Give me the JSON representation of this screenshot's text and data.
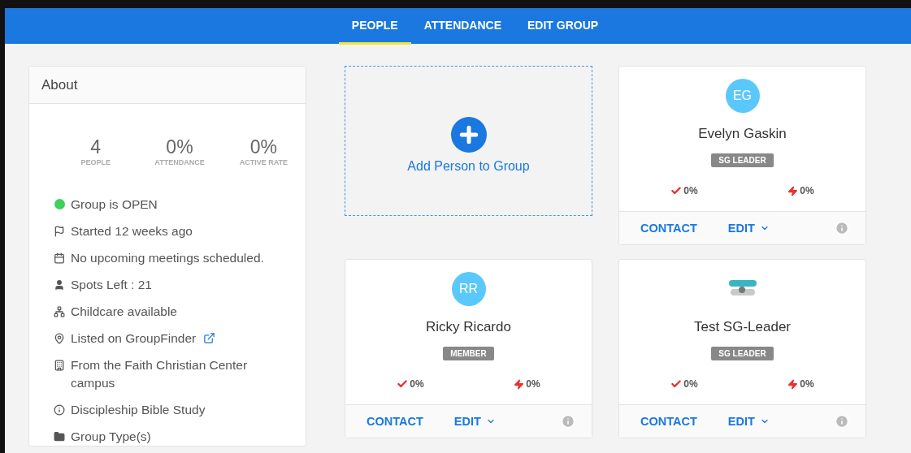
{
  "nav": {
    "tabs": [
      {
        "label": "PEOPLE",
        "selected": true
      },
      {
        "label": "ATTENDANCE",
        "selected": false
      },
      {
        "label": "EDIT GROUP",
        "selected": false
      }
    ]
  },
  "about": {
    "title": "About",
    "stats": [
      {
        "value": "4",
        "label": "PEOPLE"
      },
      {
        "value": "0%",
        "label": "ATTENDANCE"
      },
      {
        "value": "0%",
        "label": "ACTIVE RATE"
      }
    ],
    "details": [
      {
        "kind": "status",
        "text": "Group is OPEN",
        "color": "#3fd15c"
      },
      {
        "kind": "started",
        "text": "Started 12 weeks ago"
      },
      {
        "kind": "meetings",
        "text": "No upcoming meetings scheduled."
      },
      {
        "kind": "spots",
        "text": "Spots Left : 21"
      },
      {
        "kind": "childcare",
        "text": "Childcare available"
      },
      {
        "kind": "listing",
        "text": "Listed on GroupFinder"
      },
      {
        "kind": "campus",
        "text": "From the Faith Christian Center campus"
      },
      {
        "kind": "type",
        "text": "Discipleship Bible Study"
      },
      {
        "kind": "types",
        "text": "Group Type(s)"
      }
    ]
  },
  "add_card": {
    "label": "Add Person to Group"
  },
  "people": [
    {
      "avatar": {
        "kind": "initials",
        "text": "EG"
      },
      "name": "Evelyn Gaskin",
      "role": "SG LEADER",
      "attendance": "0%",
      "activity": "0%",
      "actions": [
        "CONTACT",
        "EDIT"
      ]
    },
    {
      "avatar": {
        "kind": "initials",
        "text": "RR"
      },
      "name": "Ricky Ricardo",
      "role": "MEMBER",
      "attendance": "0%",
      "activity": "0%",
      "actions": [
        "CONTACT",
        "EDIT"
      ]
    },
    {
      "avatar": {
        "kind": "picture"
      },
      "name": "Test SG-Leader",
      "role": "SG LEADER",
      "attendance": "0%",
      "activity": "0%",
      "actions": [
        "CONTACT",
        "EDIT"
      ]
    }
  ]
}
